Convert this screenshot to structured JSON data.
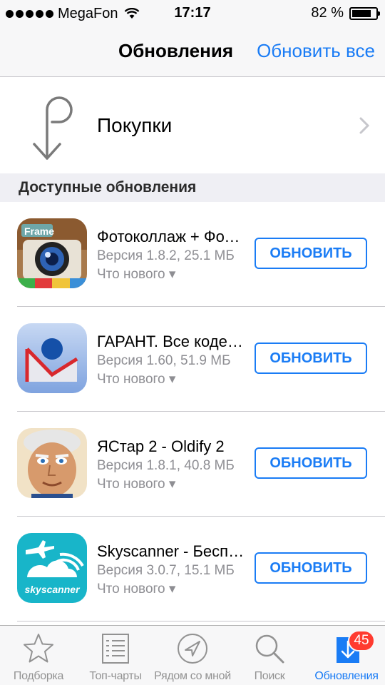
{
  "status_bar": {
    "carrier": "MegaFon",
    "time": "17:17",
    "battery_percent": "82 %",
    "battery_level": 0.82
  },
  "nav": {
    "title": "Обновления",
    "update_all": "Обновить все"
  },
  "purchases": {
    "label": "Покупки"
  },
  "section": {
    "title": "Доступные обновления"
  },
  "apps": [
    {
      "name": "Фотоколлаж + Фоторедактор",
      "version": "Версия 1.8.2, 25.1 МБ",
      "whats_new": "Что нового ▾",
      "button": "ОБНОВИТЬ",
      "icon": "photo-collage-icon"
    },
    {
      "name": "ГАРАНТ. Все кодексы РФ",
      "version": "Версия 1.60, 51.9 МБ",
      "whats_new": "Что нового ▾",
      "button": "ОБНОВИТЬ",
      "icon": "garant-icon"
    },
    {
      "name": "ЯСтар 2 - Oldify 2",
      "version": "Версия 1.8.1, 40.8 МБ",
      "whats_new": "Что нового ▾",
      "button": "ОБНОВИТЬ",
      "icon": "oldify-icon"
    },
    {
      "name": "Skyscanner - Бесплатный поиск авиабилетов",
      "version": "Версия 3.0.7, 15.1 МБ",
      "whats_new": "Что нового ▾",
      "button": "ОБНОВИТЬ",
      "icon": "skyscanner-icon",
      "icon_text": "skyscanner"
    }
  ],
  "tabs": [
    {
      "label": "Подборка",
      "icon": "star-icon"
    },
    {
      "label": "Топ-чарты",
      "icon": "list-icon"
    },
    {
      "label": "Рядом со мной",
      "icon": "location-icon"
    },
    {
      "label": "Поиск",
      "icon": "search-icon"
    },
    {
      "label": "Обновления",
      "icon": "download-icon",
      "active": true,
      "badge": "45"
    }
  ],
  "colors": {
    "accent": "#1a7cf5",
    "badge": "#ff3b30",
    "secondary_text": "#8e8e93"
  }
}
